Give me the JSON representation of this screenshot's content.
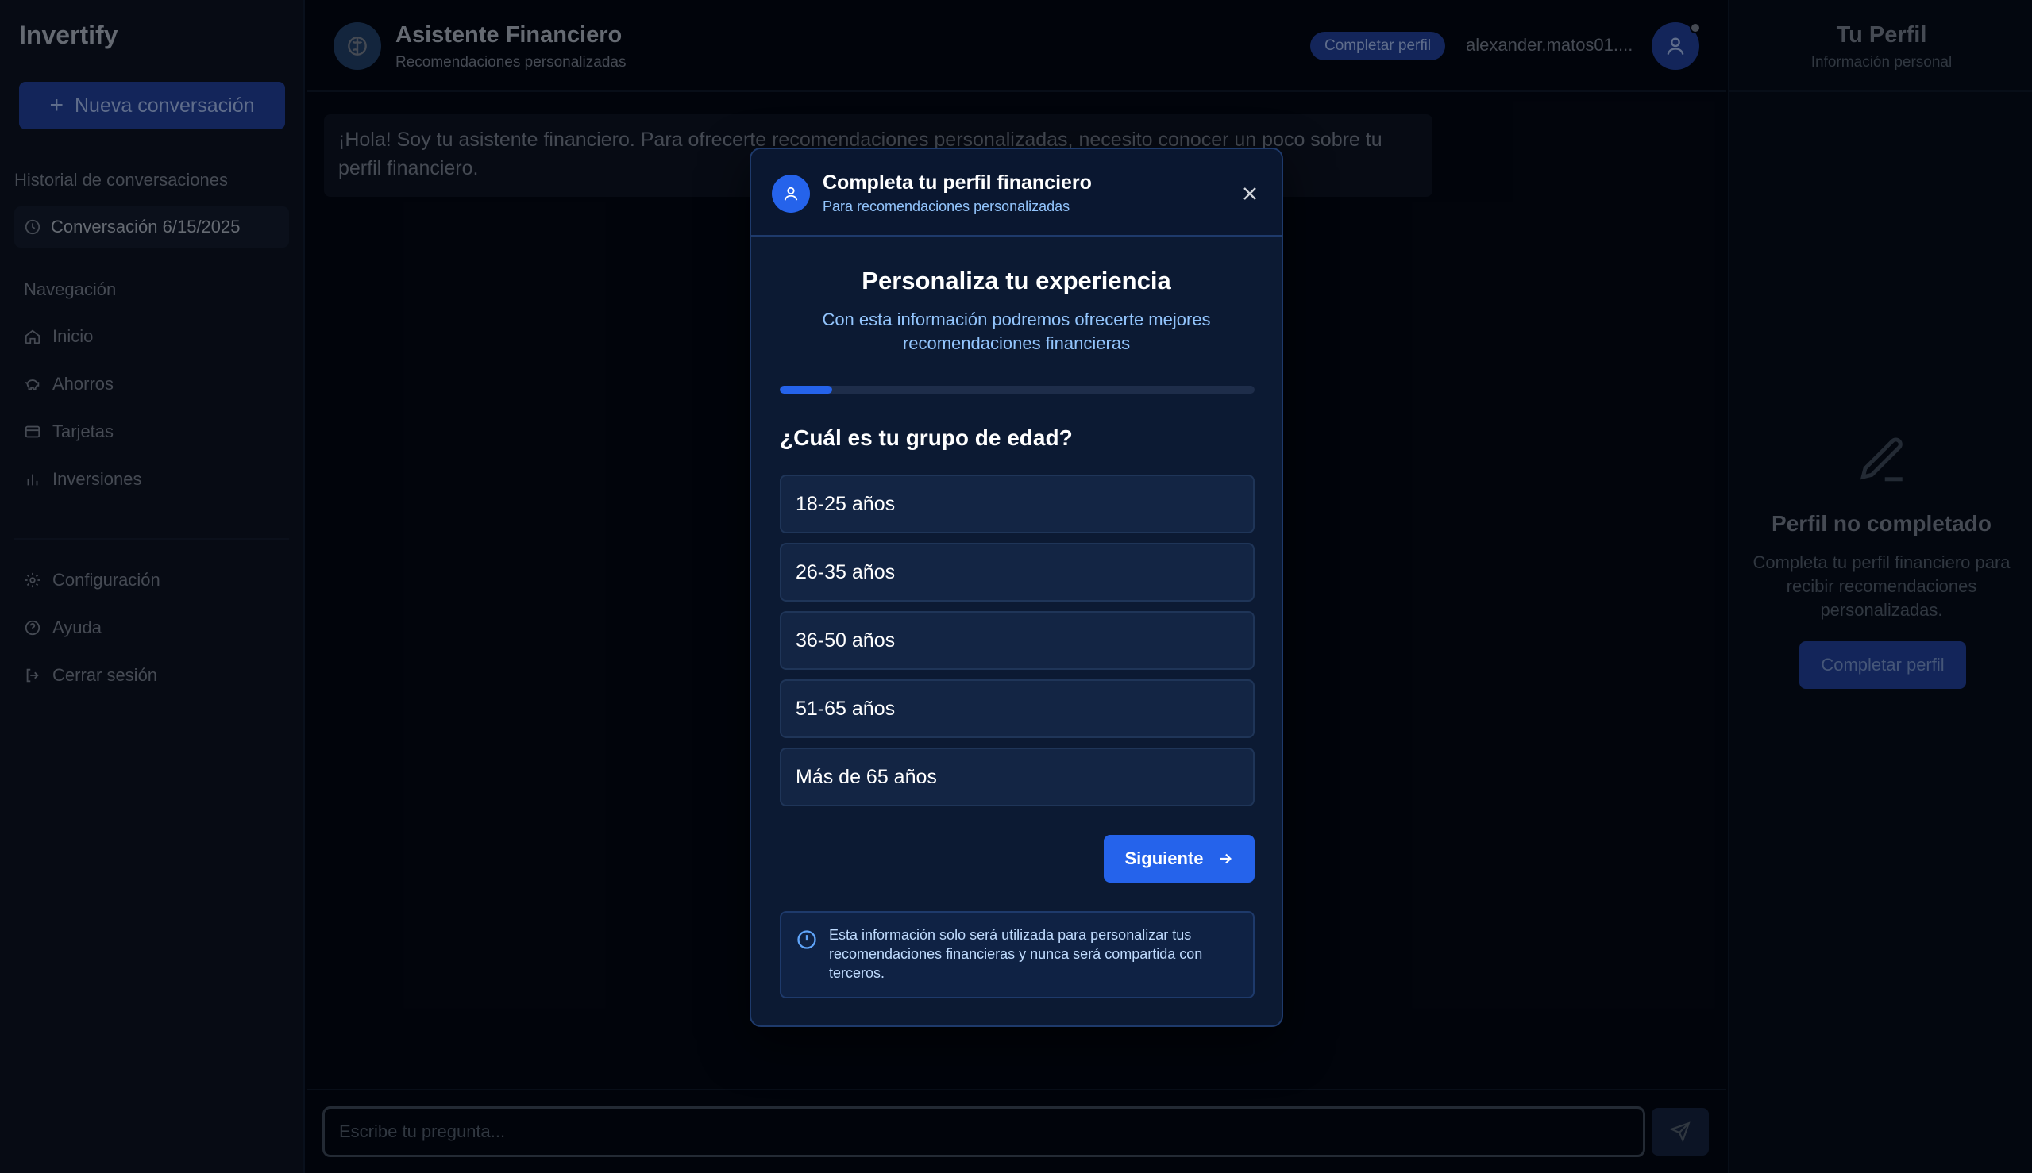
{
  "sidebar": {
    "brand": "Invertify",
    "new_chat_label": "Nueva conversación",
    "history_label": "Historial de conversaciones",
    "history_items": [
      {
        "label": "Conversación 6/15/2025"
      }
    ],
    "nav_label": "Navegación",
    "nav_items": [
      {
        "label": "Inicio",
        "icon": "home-icon"
      },
      {
        "label": "Ahorros",
        "icon": "piggy-bank-icon"
      },
      {
        "label": "Tarjetas",
        "icon": "credit-card-icon"
      },
      {
        "label": "Inversiones",
        "icon": "bar-chart-icon"
      }
    ],
    "bottom_items": [
      {
        "label": "Configuración",
        "icon": "gear-icon"
      },
      {
        "label": "Ayuda",
        "icon": "help-icon"
      },
      {
        "label": "Cerrar sesión",
        "icon": "logout-icon"
      }
    ]
  },
  "header": {
    "title": "Asistente Financiero",
    "subtitle": "Recomendaciones personalizadas",
    "complete_badge": "Completar perfil",
    "user_email": "alexander.matos01...."
  },
  "chat": {
    "welcome_message": "¡Hola! Soy tu asistente financiero. Para ofrecerte recomendaciones personalizadas, necesito conocer un poco sobre tu perfil financiero.",
    "input_placeholder": "Escribe tu pregunta..."
  },
  "right_panel": {
    "title": "Tu Perfil",
    "subtitle": "Información personal",
    "empty_title": "Perfil no completado",
    "empty_text": "Completa tu perfil financiero para recibir recomendaciones personalizadas.",
    "button_label": "Completar perfil"
  },
  "modal": {
    "title": "Completa tu perfil financiero",
    "subtitle": "Para recomendaciones personalizadas",
    "heading": "Personaliza tu experiencia",
    "description": "Con esta información podremos ofrecerte mejores recomendaciones financieras",
    "progress_fraction": 0.11,
    "question": "¿Cuál es tu grupo de edad?",
    "options": [
      {
        "label": "18-25 años"
      },
      {
        "label": "26-35 años"
      },
      {
        "label": "36-50 años"
      },
      {
        "label": "51-65 años"
      },
      {
        "label": "Más de 65 años"
      }
    ],
    "next_label": "Siguiente",
    "info_text": "Esta información solo será utilizada para personalizar tus recomendaciones financieras y nunca será compartida con terceros."
  },
  "colors": {
    "accent": "#2563eb",
    "background": "#030712",
    "modal_background": "#0c1a33"
  }
}
